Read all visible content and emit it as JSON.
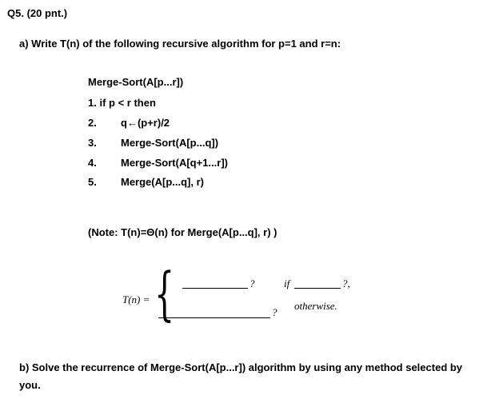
{
  "question": {
    "header": "Q5. (20 pnt.)",
    "part_a": "a) Write T(n) of the following recursive algorithm for p=1 and r=n:",
    "algorithm": {
      "title": "Merge-Sort(A[p...r])",
      "lines": [
        {
          "num": "1.",
          "text": "if p < r then"
        },
        {
          "num": "2.",
          "text": "q←(p+r)/2"
        },
        {
          "num": "3.",
          "text": "Merge-Sort(A[p...q])"
        },
        {
          "num": "4.",
          "text": "Merge-Sort(A[q+1...r])"
        },
        {
          "num": "5.",
          "text": "Merge(A[p...q], r)"
        }
      ]
    },
    "note": "(Note: T(n)=Θ(n)  for Merge(A[p...q], r) )",
    "recurrence": {
      "lhs": "T(n) =",
      "case1_blank_mark": "?",
      "case1_condition_if": "if",
      "case1_condition_mark": "?,",
      "case2_blank_mark": "?",
      "case2_condition": "otherwise."
    },
    "part_b_line1": "b) Solve the recurrence of Merge-Sort(A[p...r]) algorithm by using any method selected by",
    "part_b_line2": "you."
  }
}
